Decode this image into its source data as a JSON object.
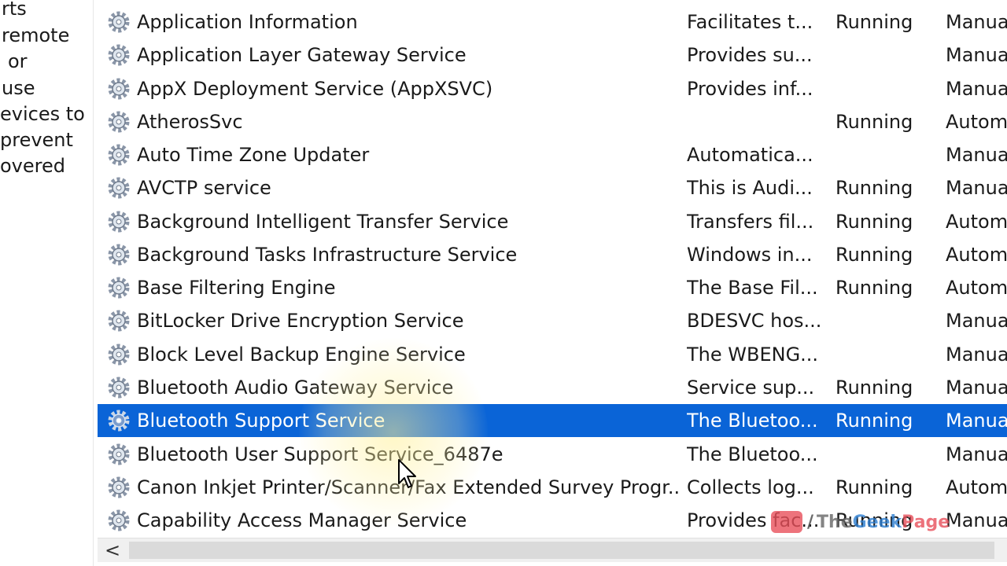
{
  "description_pane": {
    "lines": [
      "rts",
      "remote",
      "or",
      "use",
      "evices to",
      "prevent",
      "overed"
    ]
  },
  "services": [
    {
      "name": "Application Information",
      "description": "Facilitates t...",
      "status": "Running",
      "startup": "Manua"
    },
    {
      "name": "Application Layer Gateway Service",
      "description": "Provides su...",
      "status": "",
      "startup": "Manua"
    },
    {
      "name": "AppX Deployment Service (AppXSVC)",
      "description": "Provides inf...",
      "status": "",
      "startup": "Manua"
    },
    {
      "name": "AtherosSvc",
      "description": "",
      "status": "Running",
      "startup": "Autom"
    },
    {
      "name": "Auto Time Zone Updater",
      "description": "Automatica...",
      "status": "",
      "startup": "Manua"
    },
    {
      "name": "AVCTP service",
      "description": "This is Audi...",
      "status": "Running",
      "startup": "Manua"
    },
    {
      "name": "Background Intelligent Transfer Service",
      "description": "Transfers fil...",
      "status": "Running",
      "startup": "Autom"
    },
    {
      "name": "Background Tasks Infrastructure Service",
      "description": "Windows in...",
      "status": "Running",
      "startup": "Autom"
    },
    {
      "name": "Base Filtering Engine",
      "description": "The Base Fil...",
      "status": "Running",
      "startup": "Autom"
    },
    {
      "name": "BitLocker Drive Encryption Service",
      "description": "BDESVC hos...",
      "status": "",
      "startup": "Manua"
    },
    {
      "name": "Block Level Backup Engine Service",
      "description": "The WBENG...",
      "status": "",
      "startup": "Manua"
    },
    {
      "name": "Bluetooth Audio Gateway Service",
      "description": "Service sup...",
      "status": "Running",
      "startup": "Manua"
    },
    {
      "name": "Bluetooth Support Service",
      "description": "The Bluetoo...",
      "status": "Running",
      "startup": "Manua"
    },
    {
      "name": "Bluetooth User Support Service_6487e",
      "description": "The Bluetoo...",
      "status": "",
      "startup": "Manua"
    },
    {
      "name": "Canon Inkjet Printer/Scanner/Fax Extended Survey Progr...",
      "description": "Collects log...",
      "status": "Running",
      "startup": "Autom"
    },
    {
      "name": "Capability Access Manager Service",
      "description": "Provides fac...",
      "status": "Running",
      "startup": "Manua"
    }
  ],
  "selected_service": "Bluetooth Support Service",
  "scrollbar": {
    "left_arrow": "<"
  },
  "watermark": {
    "prefix": "/",
    "part1": "The",
    "part2": "Geek",
    "part3": "Page"
  },
  "colors": {
    "selection": "#0a64d7",
    "gear": "#8a96a8",
    "watermark_blue": "#2e7fd1",
    "watermark_red": "#e8505b"
  }
}
